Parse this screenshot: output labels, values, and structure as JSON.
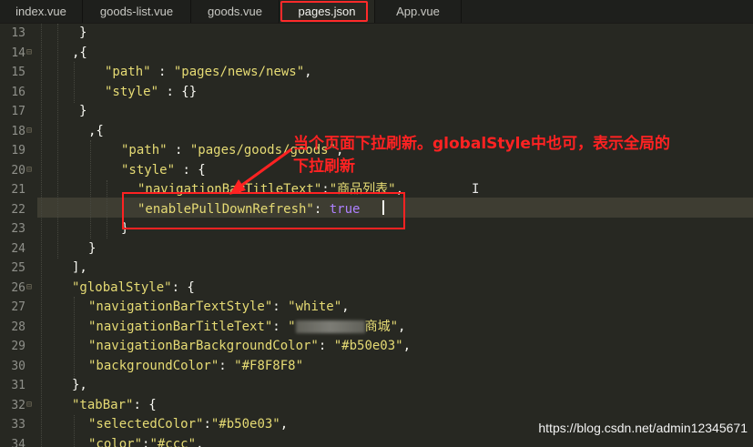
{
  "tabs": [
    {
      "label": "index.vue",
      "active": false
    },
    {
      "label": "goods-list.vue",
      "active": false
    },
    {
      "label": "goods.vue",
      "active": false
    },
    {
      "label": "pages.json",
      "active": true
    },
    {
      "label": "App.vue",
      "active": false
    }
  ],
  "gutter": {
    "line_numbers": [
      "13",
      "14",
      "15",
      "16",
      "17",
      "18",
      "19",
      "20",
      "21",
      "22",
      "23",
      "24",
      "25",
      "26",
      "27",
      "28",
      "29",
      "30",
      "31",
      "32",
      "33",
      "34"
    ]
  },
  "code": {
    "l13": "}",
    "l14": ",{",
    "l15_key": "\"path\"",
    "l15_sep": " : ",
    "l15_val": "\"pages/news/news\"",
    "l15_end": ",",
    "l16_key": "\"style\"",
    "l16_rest": " : {}",
    "l17": "}",
    "l18": ",{",
    "l19_key": "\"path\"",
    "l19_sep": " : ",
    "l19_val": "\"pages/goods/goods\"",
    "l19_end": ",",
    "l20_key": "\"style\"",
    "l20_rest": " : {",
    "l21_key": "\"navigationBarTitleText\"",
    "l21_sep": ":",
    "l21_val": "\"商品列表\"",
    "l21_end": ",",
    "l22_key": "\"enablePullDownRefresh\"",
    "l22_sep": ": ",
    "l22_val": "true",
    "l23": "}",
    "l24": "}",
    "l25": "],",
    "l26_key": "\"globalStyle\"",
    "l26_rest": ": {",
    "l27_key": "\"navigationBarTextStyle\"",
    "l27_sep": ": ",
    "l27_val": "\"white\"",
    "l27_end": ",",
    "l28_key": "\"navigationBarTitleText\"",
    "l28_sep": ": ",
    "l28_val_a": "\"",
    "l28_val_b": "商城\"",
    "l28_end": ",",
    "l29_key": "\"navigationBarBackgroundColor\"",
    "l29_sep": ": ",
    "l29_val": "\"#b50e03\"",
    "l29_end": ",",
    "l30_key": "\"backgroundColor\"",
    "l30_sep": ": ",
    "l30_val": "\"#F8F8F8\"",
    "l31": "},",
    "l32_key": "\"tabBar\"",
    "l32_rest": ": {",
    "l33_key": "\"selectedColor\"",
    "l33_sep": ":",
    "l33_val": "\"#b50e03\"",
    "l33_end": ",",
    "l34_key": "\"color\"",
    "l34_sep": ":",
    "l34_val": "\"#ccc\"",
    "l34_end": ","
  },
  "annotation": {
    "text": "当个页面下拉刷新。globalStyle中也可，表示全局的\n下拉刷新"
  },
  "watermark": "https://blog.csdn.net/admin12345671",
  "colors": {
    "background": "#272822",
    "string": "#e6db74",
    "keyword": "#ae81ff",
    "annotation": "#ff2222"
  }
}
